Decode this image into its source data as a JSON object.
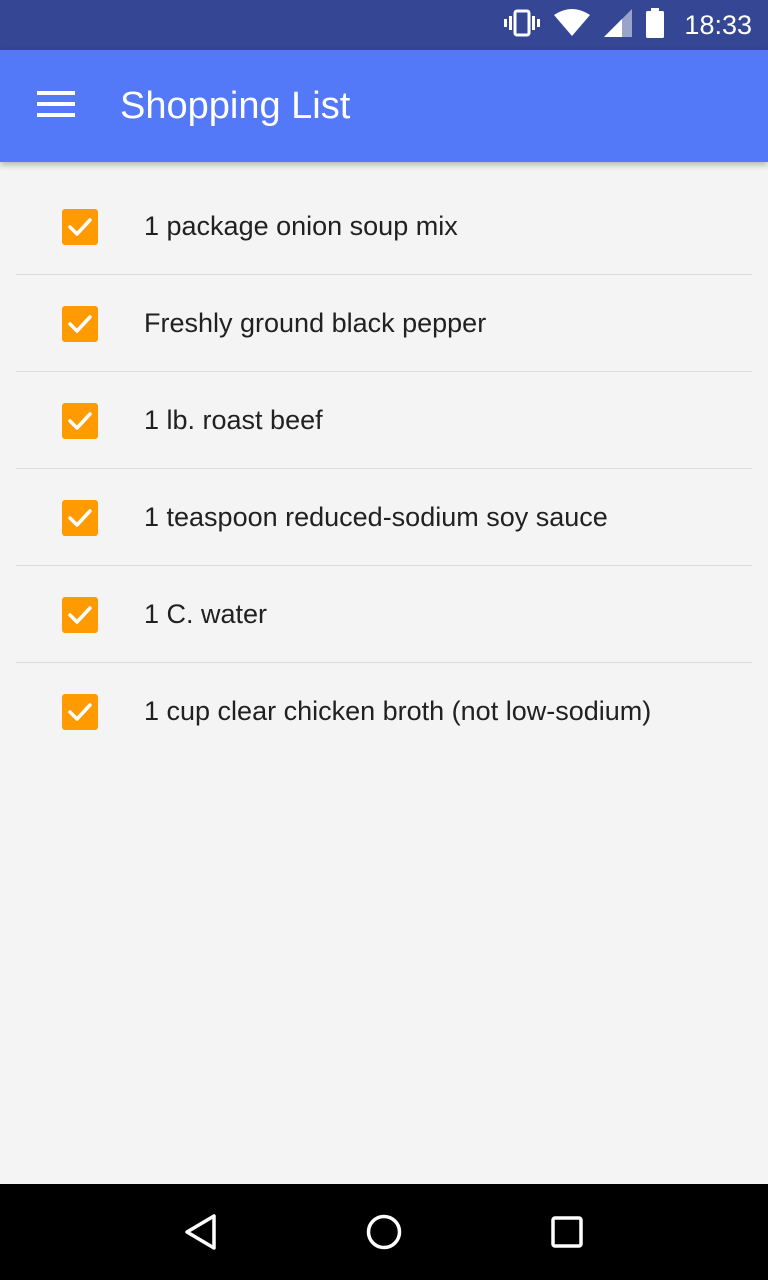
{
  "status_bar": {
    "time": "18:33",
    "icons": [
      "vibrate-icon",
      "wifi-icon",
      "signal-icon",
      "battery-icon"
    ]
  },
  "app_bar": {
    "title": "Shopping List",
    "menu_icon": "menu-icon",
    "color": "#5378f8"
  },
  "list": {
    "checkbox_color": "#ff9a00",
    "items": [
      {
        "label": "1 package onion soup mix",
        "checked": true
      },
      {
        "label": "Freshly ground black pepper",
        "checked": true
      },
      {
        "label": "1 lb. roast beef",
        "checked": true
      },
      {
        "label": "1 teaspoon reduced-sodium soy sauce",
        "checked": true
      },
      {
        "label": "1 C. water",
        "checked": true
      },
      {
        "label": "1 cup clear chicken broth (not low-sodium)",
        "checked": true
      }
    ]
  },
  "nav_bar": {
    "buttons": [
      "back-icon",
      "home-icon",
      "recents-icon"
    ]
  }
}
